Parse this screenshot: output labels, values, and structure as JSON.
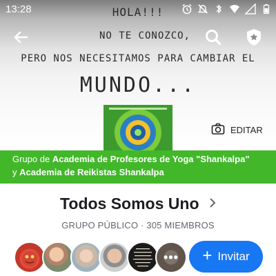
{
  "status_bar": {
    "time": "13:28",
    "icons": [
      "alarm-icon",
      "notifications-muted-icon",
      "bluetooth-icon",
      "wifi-icon",
      "signal-icon",
      "battery-icon"
    ]
  },
  "cover": {
    "lines": [
      "HOLA!!!",
      "NO TE CONOZCO,",
      "PERO NOS NECESITAMOS PARA CAMBIAR EL",
      "MUNDO..."
    ],
    "edit_label": "EDITAR"
  },
  "toolbar": {
    "back_icon": "arrow-left-icon",
    "search_icon": "search-icon",
    "shield_icon": "shield-star-icon"
  },
  "group_band": {
    "prefix": "Grupo de ",
    "groups": "Academia de Profesores de Yoga \"Shankalpa\"",
    "conjunction": "y",
    "second_group": "Academia de Reikistas Shankalpa"
  },
  "group": {
    "title": "Todos Somos Uno",
    "meta": "GRUPO PÚBLICO · 305 MIEMBROS"
  },
  "members": {
    "more_label": "•••"
  },
  "invite": {
    "label": "Invitar",
    "plus": "+"
  },
  "colors": {
    "accent_green": "#42b72a",
    "invite_blue": "#1877f2"
  }
}
